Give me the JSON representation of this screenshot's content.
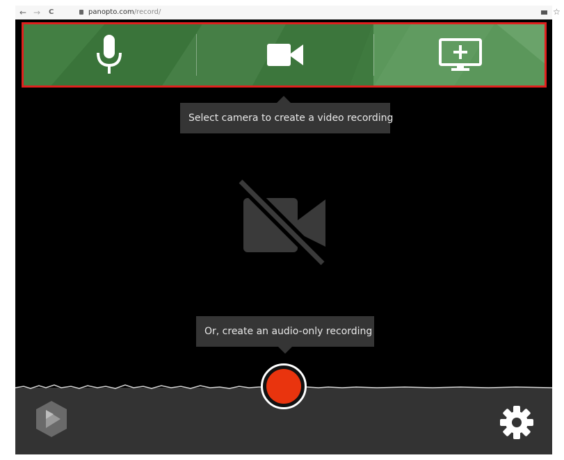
{
  "browser": {
    "back": "←",
    "forward": "→",
    "reload": "C",
    "url_host": "panopto.com",
    "url_path": "/record/",
    "star": "☆"
  },
  "sources": [
    {
      "name": "microphone",
      "icon": "microphone-icon",
      "active": false
    },
    {
      "name": "camera",
      "icon": "video-camera-icon",
      "active": false
    },
    {
      "name": "screen",
      "icon": "add-screen-icon",
      "active": true
    }
  ],
  "tooltips": {
    "camera_hint": "Select camera to create a video recording",
    "audio_hint": "Or, create an audio-only recording"
  },
  "colors": {
    "source_bar": "#3f7a3f",
    "source_bar_active": "#5b975b",
    "highlight": "#e0201e",
    "record": "#e9340e",
    "tooltip_bg": "#353535",
    "bottom_bar": "#333333"
  },
  "icons": {
    "preview": "camera-off-icon",
    "logo": "panopto-logo-icon",
    "settings": "gear-icon",
    "record": "record-button"
  }
}
